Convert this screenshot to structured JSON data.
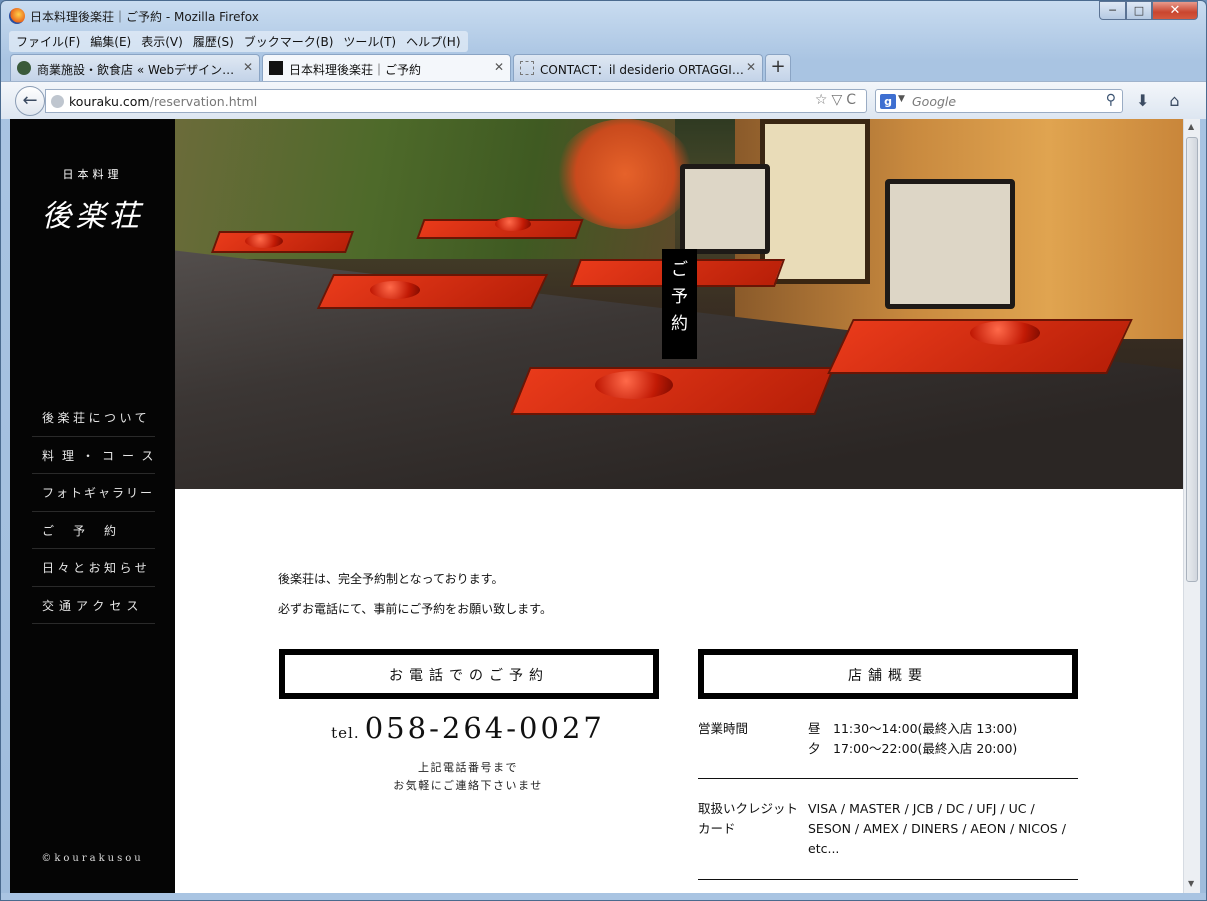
{
  "window": {
    "title": "日本料理後楽荘｜ご予約 - Mozilla Firefox",
    "controls": {
      "minimize": "─",
      "maximize": "□",
      "close": "✕"
    }
  },
  "menu": [
    "ファイル(F)",
    "編集(E)",
    "表示(V)",
    "履歴(S)",
    "ブックマーク(B)",
    "ツール(T)",
    "ヘルプ(H)"
  ],
  "tabs": [
    {
      "label": "商業施設・飲食店 « Webデザイン…",
      "active": false
    },
    {
      "label": "日本料理後楽荘｜ご予約",
      "active": true
    },
    {
      "label": "CONTACT：il desiderio ORTAGGI…",
      "active": false
    }
  ],
  "tab_new": "+",
  "nav": {
    "back": "←",
    "url_domain": "kouraku.com",
    "url_path": "/reservation.html",
    "url_icons": "☆▽C",
    "search_engine": "g",
    "search_placeholder": "Google",
    "search_icon": "⚲",
    "download_icon": "⬇",
    "home_icon": "⌂"
  },
  "site": {
    "logo_small": "日本料理",
    "logo_big": "後楽荘",
    "nav": [
      "後楽荘について",
      "料理・コース",
      "フォトギャラリー",
      "ご予約",
      "日々とお知らせ",
      "交通アクセス"
    ],
    "copyright": "©kourakusou"
  },
  "hero": {
    "label_line1": "ご",
    "label_line2": "予",
    "label_line3": "約"
  },
  "content": {
    "intro_1": "後楽荘は、完全予約制となっております。",
    "intro_2": "必ずお電話にて、事前にご予約をお願い致します。",
    "phone_heading": "お電話でのご予約",
    "tel_prefix": "tel.",
    "tel_number": "058-264-0027",
    "tel_note_1": "上記電話番号まで",
    "tel_note_2": "お気軽にご連絡下さいませ",
    "store_heading": "店舗概要",
    "hours_label": "営業時間",
    "hours_lunch": "昼　11:30〜14:00(最終入店 13:00)",
    "hours_dinner": "夕　17:00〜22:00(最終入店 20:00)",
    "cards_label_1": "取扱いクレジット",
    "cards_label_2": "カード",
    "cards_value": "VISA / MASTER / JCB / DC / UFJ / UC / SESON / AMEX / DINERS / AEON / NICOS / etc..."
  }
}
